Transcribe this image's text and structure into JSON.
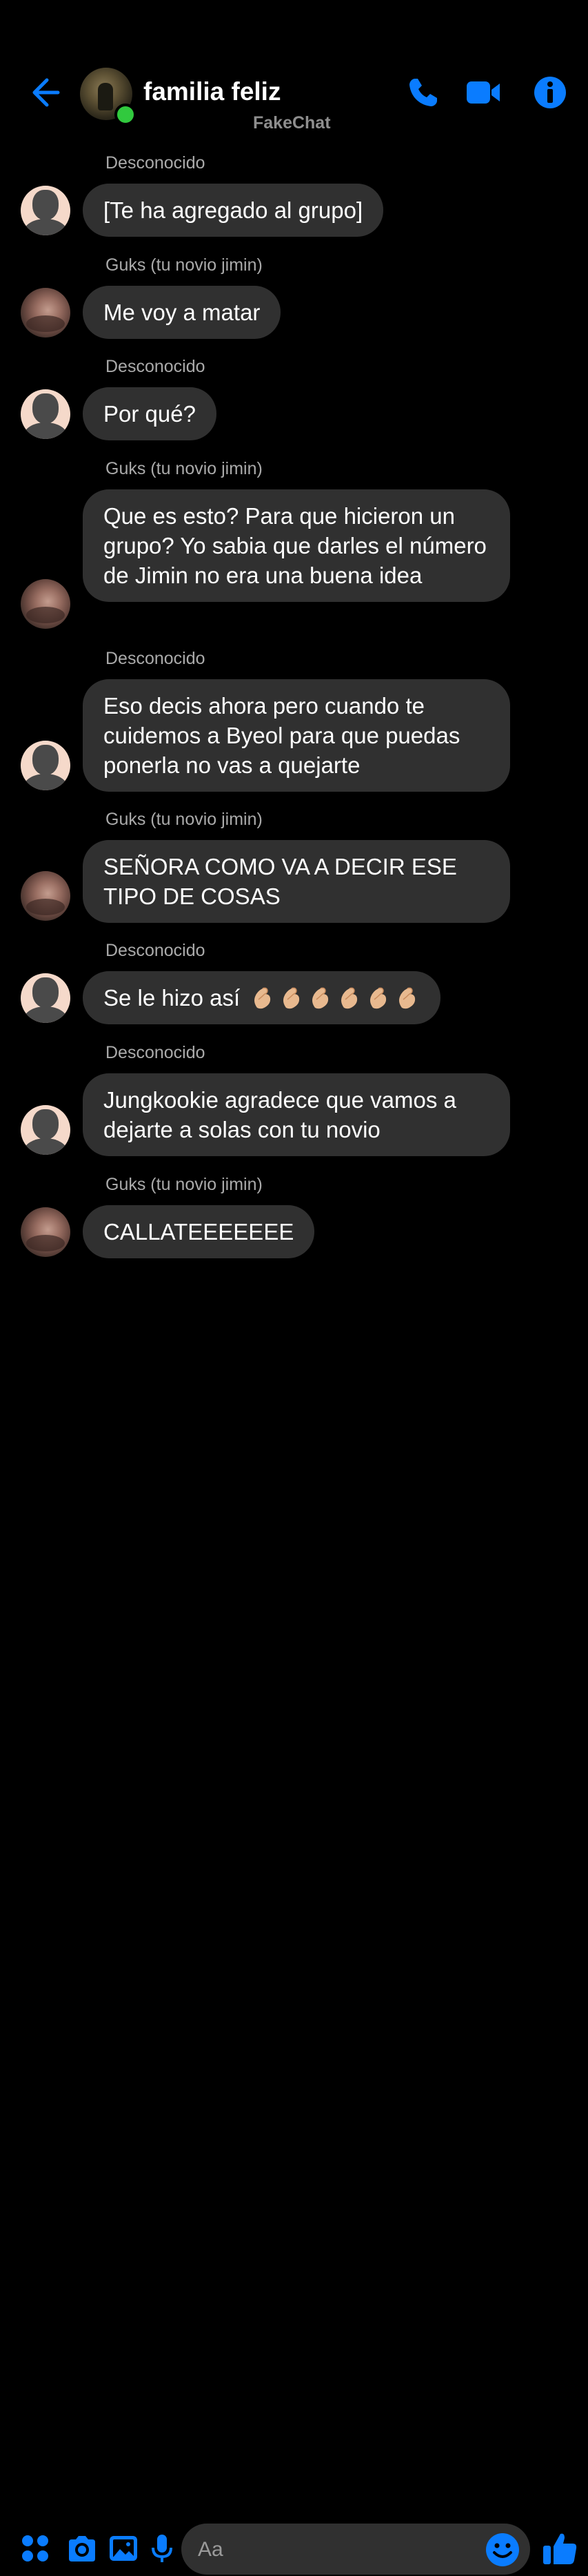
{
  "header": {
    "title": "familia feliz",
    "watermark": "FakeChat"
  },
  "colors": {
    "accent": "#0a7cff",
    "bubble": "#303030",
    "background": "#000000",
    "online": "#31c93e",
    "sender_text": "#aaaaaa"
  },
  "icons": {
    "back": "arrow-left-icon",
    "call": "phone-icon",
    "video": "video-camera-icon",
    "info": "info-icon",
    "menu": "grid-dots-icon",
    "camera": "camera-icon",
    "gallery": "image-icon",
    "mic": "microphone-icon",
    "emoji": "smiley-icon",
    "like": "thumbs-up-icon"
  },
  "messages": [
    {
      "sender": "Desconocido",
      "text": "[Te ha agregado al grupo]",
      "avatar": "default-avatar"
    },
    {
      "sender": "Guks (tu novio jimin)",
      "text": "Me voy a matar",
      "avatar": "photo-avatar"
    },
    {
      "sender": "Desconocido",
      "text": "Por qué?",
      "avatar": "default-avatar"
    },
    {
      "sender": "Guks (tu novio jimin)",
      "text": "Que es esto? Para que hicieron un grupo? Yo sabia que darles el número de Jimin no era una buena idea",
      "avatar": "photo-avatar"
    },
    {
      "sender": "Desconocido",
      "text": "Eso decis ahora pero cuando te cuidemos a Byeol para que puedas ponerla no vas a quejarte",
      "avatar": "default-avatar"
    },
    {
      "sender": "Guks (tu novio jimin)",
      "text": "SEÑORA COMO VA A DECIR ESE TIPO DE COSAS",
      "avatar": "photo-avatar"
    },
    {
      "sender": "Desconocido",
      "text": "Se le hizo así",
      "emoji": "pinched-fingers",
      "emoji_count": 6,
      "avatar": "default-avatar"
    },
    {
      "sender": "Desconocido",
      "text": "Jungkookie agradece que vamos a dejarte a solas con tu novio",
      "avatar": "default-avatar"
    },
    {
      "sender": "Guks (tu novio jimin)",
      "text": "CALLATEEEEEEE",
      "avatar": "photo-avatar"
    }
  ],
  "composer": {
    "placeholder": "Aa"
  }
}
